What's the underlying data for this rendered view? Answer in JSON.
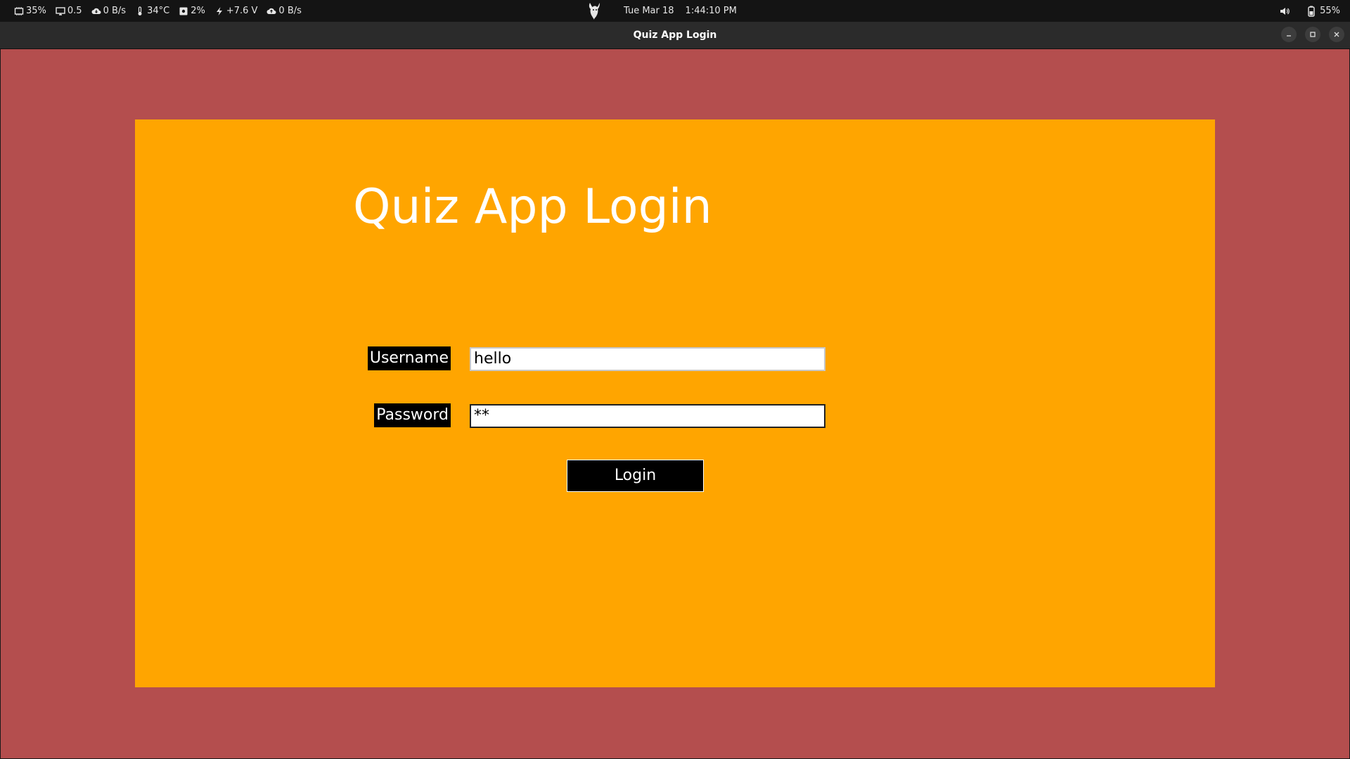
{
  "system_bar": {
    "stats": [
      {
        "icon": "cpu-icon",
        "value": "35%"
      },
      {
        "icon": "monitor-icon",
        "value": "0.5"
      },
      {
        "icon": "cloud-download-icon",
        "value": "0 B/s"
      },
      {
        "icon": "thermometer-icon",
        "value": "34°C"
      },
      {
        "icon": "disk-icon",
        "value": "2%"
      },
      {
        "icon": "voltage-icon",
        "value": "+7.6 V"
      },
      {
        "icon": "cloud-upload-icon",
        "value": "0 B/s"
      }
    ],
    "date": "Tue Mar 18",
    "time": "1:44:10 PM",
    "battery": "55%"
  },
  "window": {
    "title": "Quiz App Login"
  },
  "login": {
    "heading": "Quiz App Login",
    "username_label": "Username",
    "username_value": "hello",
    "password_label": "Password",
    "password_value": "**",
    "login_button": "Login"
  },
  "colors": {
    "window_bg": "#b44e4e",
    "panel_bg": "#ffa500",
    "label_bg": "#000000",
    "text_light": "#ffffff"
  }
}
